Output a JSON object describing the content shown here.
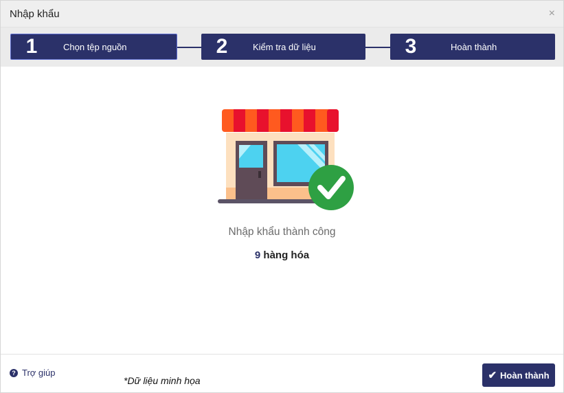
{
  "dialog": {
    "title": "Nhập khẩu",
    "close_icon": "×"
  },
  "steps": [
    {
      "number": "1",
      "label": "Chọn tệp nguồn",
      "active": true
    },
    {
      "number": "2",
      "label": "Kiểm tra dữ liệu",
      "active": false
    },
    {
      "number": "3",
      "label": "Hoàn thành",
      "active": false
    }
  ],
  "result": {
    "message": "Nhập khẩu thành công",
    "count": "9",
    "unit": "hàng hóa",
    "illustration_icon": "store-success-icon"
  },
  "footer": {
    "help_label": "Trợ giúp",
    "help_icon": "?",
    "note": "*Dữ liệu minh họa",
    "finish_label": "Hoàn thành",
    "finish_icon": "✔"
  },
  "colors": {
    "primary": "#2b3169",
    "success": "#2ea043",
    "awning_red": "#e8112d",
    "awning_orange": "#ff5a1f"
  }
}
